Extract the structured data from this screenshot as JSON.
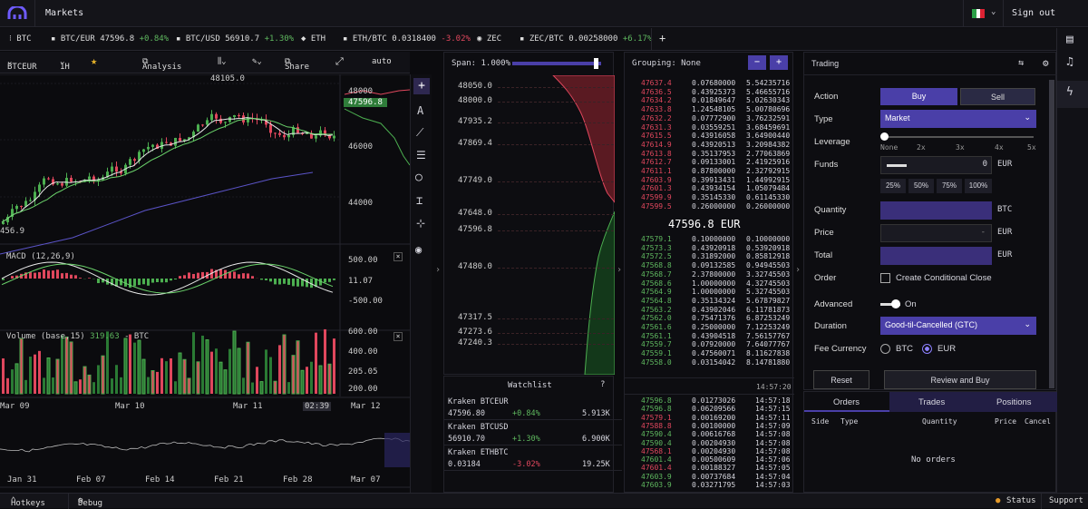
{
  "nav": {
    "markets": "Markets",
    "sign_out": "Sign out"
  },
  "tickers": [
    {
      "sym": "BTC"
    },
    {
      "sym": "BTC/EUR",
      "price": "47596.8",
      "chg": "+0.84%",
      "dir": "pos"
    },
    {
      "sym": "BTC/USD",
      "price": "56910.7",
      "chg": "+1.30%",
      "dir": "pos"
    },
    {
      "sym": "ETH"
    },
    {
      "sym": "ETH/BTC",
      "price": "0.0318400",
      "chg": "-3.02%",
      "dir": "neg"
    },
    {
      "sym": "ZEC"
    },
    {
      "sym": "ZEC/BTC",
      "price": "0.00258000",
      "chg": "+6.17%",
      "dir": "pos"
    }
  ],
  "add_tab": "+",
  "toolbar": {
    "pair": "BTCEUR",
    "interval": "1H",
    "analysis": "Analysis",
    "share": "Share",
    "auto": "auto"
  },
  "price_chart": {
    "high_label": "48105.0",
    "low_label": "456.9",
    "last": "47596.8",
    "yticks": [
      "48000",
      "46000",
      "44000"
    ],
    "colors": {
      "up": "#4caf50",
      "down": "#e0475d",
      "ma1": "#e8e8e8",
      "ma2": "#6bd36b",
      "ma3": "#5b54c8"
    }
  },
  "macd": {
    "title": "MACD (12,26,9)",
    "yticks": [
      "500.00",
      "11.07",
      "-500.00"
    ]
  },
  "volume": {
    "title": "Volume (base,15)",
    "value": "319.63",
    "unit": "- BTC",
    "yticks": [
      "600.00",
      "400.00",
      "205.05",
      "200.00"
    ]
  },
  "xaxis": [
    "Mar 09",
    "Mar 10",
    "Mar 11",
    "02:39",
    "Mar 12"
  ],
  "nav_axis": [
    "Jan 31",
    "Feb 07",
    "Feb 14",
    "Feb 21",
    "Feb 28",
    "Mar 07"
  ],
  "depth": {
    "span_label": "Span: 1.000%",
    "prices": [
      "48050.0",
      "48000.0",
      "47935.2",
      "47869.4",
      "47749.0",
      "47648.0",
      "47596.8",
      "47480.0",
      "47317.5",
      "47273.6",
      "47240.3"
    ]
  },
  "watchlist": {
    "title": "Watchlist",
    "help": "?",
    "rows": [
      {
        "name": "Kraken BTCEUR",
        "price": "47596.80",
        "chg": "+0.84%",
        "dir": "pos",
        "vol": "5.913K"
      },
      {
        "name": "Kraken BTCUSD",
        "price": "56910.70",
        "chg": "+1.30%",
        "dir": "pos",
        "vol": "6.900K"
      },
      {
        "name": "Kraken ETHBTC",
        "price": "0.03184",
        "chg": "-3.02%",
        "dir": "neg",
        "vol": "19.25K"
      }
    ]
  },
  "orderbook": {
    "grouping": "Grouping: None",
    "mid": "47596.8 EUR",
    "asks": [
      [
        "47637.4",
        "0.07680000",
        "5.54235716"
      ],
      [
        "47636.5",
        "0.43925373",
        "5.46655716"
      ],
      [
        "47634.2",
        "0.01849647",
        "5.02630343"
      ],
      [
        "47633.8",
        "1.24548105",
        "5.00780696"
      ],
      [
        "47632.2",
        "0.07772900",
        "3.76232591"
      ],
      [
        "47631.3",
        "0.03559251",
        "3.68459691"
      ],
      [
        "47615.5",
        "0.43916058",
        "3.64900440"
      ],
      [
        "47614.9",
        "0.43920513",
        "3.20984382"
      ],
      [
        "47613.8",
        "0.35137953",
        "2.77063869"
      ],
      [
        "47612.7",
        "0.09133001",
        "2.41925916"
      ],
      [
        "47611.1",
        "0.87800000",
        "2.32792915"
      ],
      [
        "47603.9",
        "0.39913431",
        "1.44992915"
      ],
      [
        "47601.3",
        "0.43934154",
        "1.05079484"
      ],
      [
        "47599.9",
        "0.35145330",
        "0.61145330"
      ],
      [
        "47599.5",
        "0.26000000",
        "0.26000000"
      ]
    ],
    "bids": [
      [
        "47579.1",
        "0.10000000",
        "0.10000000"
      ],
      [
        "47573.3",
        "0.43920918",
        "0.53920918"
      ],
      [
        "47572.5",
        "0.31892000",
        "0.85812918"
      ],
      [
        "47568.8",
        "0.09132585",
        "0.94945503"
      ],
      [
        "47568.7",
        "2.37800000",
        "3.32745503"
      ],
      [
        "47568.6",
        "1.00000000",
        "4.32745503"
      ],
      [
        "47564.9",
        "1.00000000",
        "5.32745503"
      ],
      [
        "47564.8",
        "0.35134324",
        "5.67879827"
      ],
      [
        "47563.2",
        "0.43902046",
        "6.11781873"
      ],
      [
        "47562.0",
        "0.75471376",
        "6.87253249"
      ],
      [
        "47561.6",
        "0.25000000",
        "7.12253249"
      ],
      [
        "47561.1",
        "0.43904518",
        "7.56157767"
      ],
      [
        "47559.7",
        "0.07920000",
        "7.64077767"
      ],
      [
        "47559.1",
        "0.47560071",
        "8.11627838"
      ],
      [
        "47558.0",
        "0.03154042",
        "8.14781880"
      ]
    ],
    "trades_time": "14:57:20",
    "trades": [
      [
        "47596.8",
        "0.01273026",
        "14:57:18",
        "pos"
      ],
      [
        "47596.8",
        "0.06209566",
        "14:57:15",
        "pos"
      ],
      [
        "47579.1",
        "0.00169200",
        "14:57:11",
        "neg"
      ],
      [
        "47588.8",
        "0.00100000",
        "14:57:09",
        "neg"
      ],
      [
        "47590.4",
        "0.00616768",
        "14:57:08",
        "pos"
      ],
      [
        "47590.4",
        "0.00204930",
        "14:57:08",
        "pos"
      ],
      [
        "47568.1",
        "0.00204930",
        "14:57:08",
        "neg"
      ],
      [
        "47601.4",
        "0.00500609",
        "14:57:06",
        "pos"
      ],
      [
        "47601.4",
        "0.00188327",
        "14:57:05",
        "neg"
      ],
      [
        "47603.9",
        "0.00737684",
        "14:57:04",
        "pos"
      ],
      [
        "47603.9",
        "0.03271795",
        "14:57:03",
        "pos"
      ]
    ]
  },
  "trading": {
    "title": "Trading",
    "action": "Action",
    "buy": "Buy",
    "sell": "Sell",
    "type": "Type",
    "type_val": "Market",
    "leverage": "Leverage",
    "lev_ticks": [
      "None",
      "2x",
      "3x",
      "4x",
      "5x"
    ],
    "funds": "Funds",
    "funds_val": "0",
    "eur": "EUR",
    "pcts": [
      "25%",
      "50%",
      "75%",
      "100%"
    ],
    "quantity": "Quantity",
    "btc": "BTC",
    "price": "Price",
    "price_val": "-",
    "total": "Total",
    "order": "Order",
    "conditional": "Create Conditional Close",
    "advanced": "Advanced",
    "on": "On",
    "duration": "Duration",
    "duration_val": "Good-til-Cancelled (GTC)",
    "fee": "Fee Currency",
    "fee_btc": "BTC",
    "fee_eur": "EUR",
    "reset": "Reset",
    "review": "Review and Buy"
  },
  "orders": {
    "tabs": [
      "Orders",
      "Trades",
      "Positions"
    ],
    "cols": [
      "Side",
      "Type",
      "Quantity",
      "Price",
      "Cancel"
    ],
    "empty": "No orders"
  },
  "bottom": {
    "hotkeys": "Hotkeys",
    "debug": "Debug",
    "status": "Status",
    "support": "Support"
  },
  "colors": {
    "accent": "#4a3fa8",
    "pos": "#5fb85f",
    "neg": "#e0475d"
  }
}
